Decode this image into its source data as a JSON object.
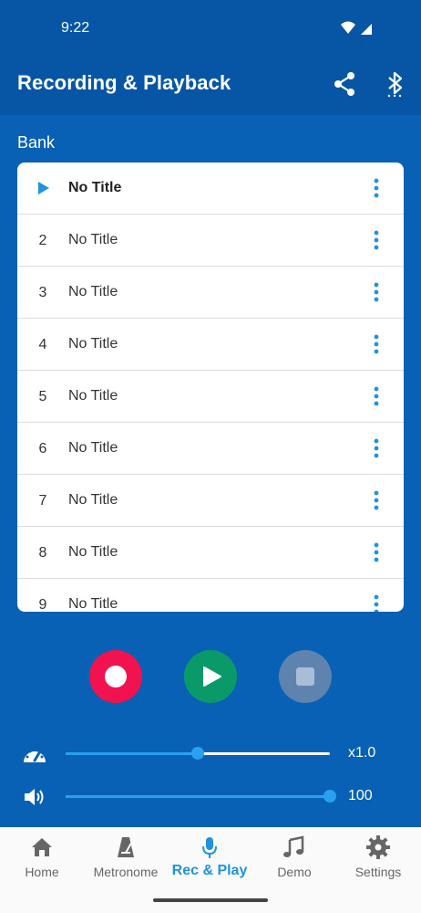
{
  "status": {
    "time": "9:22"
  },
  "appbar": {
    "title": "Recording & Playback"
  },
  "bank": {
    "label": "Bank",
    "items": [
      {
        "num": "",
        "name": "No Title",
        "active": true
      },
      {
        "num": "2",
        "name": "No Title"
      },
      {
        "num": "3",
        "name": "No Title"
      },
      {
        "num": "4",
        "name": "No Title"
      },
      {
        "num": "5",
        "name": "No Title"
      },
      {
        "num": "6",
        "name": "No Title"
      },
      {
        "num": "7",
        "name": "No Title"
      },
      {
        "num": "8",
        "name": "No Title"
      },
      {
        "num": "9",
        "name": "No Title"
      }
    ]
  },
  "tempo": {
    "value": 0.5,
    "label": "x1.0",
    "icon": "speedometer-icon"
  },
  "volume": {
    "value": 1.0,
    "label": "100",
    "icon": "volume-icon"
  },
  "nav": [
    {
      "label": "Home",
      "icon": "home-icon"
    },
    {
      "label": "Metronome",
      "icon": "metronome-icon"
    },
    {
      "label": "Rec & Play",
      "icon": "microphone-icon",
      "active": true
    },
    {
      "label": "Demo",
      "icon": "music-note-icon"
    },
    {
      "label": "Settings",
      "icon": "gear-icon"
    }
  ],
  "colors": {
    "appbar": "#0756a6",
    "background": "#0861b4",
    "accent": "#1f93e0",
    "record": "#f1124f",
    "play": "#0a9a6a"
  }
}
